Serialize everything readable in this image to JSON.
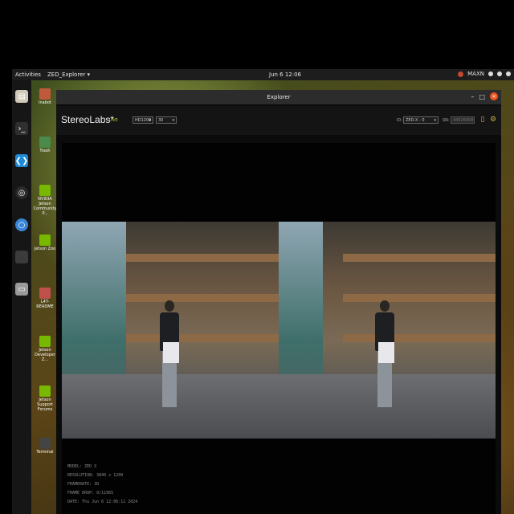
{
  "topbar": {
    "activities": "Activities",
    "app_menu": "ZED_Explorer ▾",
    "clock": "Jun 6 12:06",
    "power_mode": "MAXN"
  },
  "dock": {
    "items": [
      {
        "name": "files-icon",
        "color": "#cfc7b8"
      },
      {
        "name": "terminal-icon",
        "color": "#2f2f2f"
      },
      {
        "name": "vscode-icon",
        "color": "#1f8ad8"
      },
      {
        "name": "obs-icon",
        "color": "#2a2a2a"
      },
      {
        "name": "chromium-icon",
        "color": "#3a86d6"
      },
      {
        "name": "blank-icon",
        "color": "#3b3b3b"
      },
      {
        "name": "drive-icon",
        "color": "#9a9a9a"
      }
    ]
  },
  "desktop_icons": [
    {
      "label": "lnabot",
      "color": "#c05a3a"
    },
    {
      "label": "Trash",
      "color": "#4a8a4a"
    },
    {
      "label": "NVIDIA Jetson Community P...",
      "color": "#76b900"
    },
    {
      "label": "Jetson Zoo",
      "color": "#76b900"
    },
    {
      "label": "L4T-README",
      "color": "#c0504a"
    },
    {
      "label": "Jetson Developer Z...",
      "color": "#76b900"
    },
    {
      "label": "Jetson Support Forums",
      "color": "#76b900"
    },
    {
      "label": "Terminal",
      "color": "#444444"
    }
  ],
  "window": {
    "title": "Explorer",
    "brand": "StereoLabs*",
    "live": "LIVE",
    "resolution_select": "HD1200",
    "fps_select": "30",
    "id_label": "ID:",
    "id_select": "ZED-X - 0",
    "sn_label": "SN:",
    "sn_value": "44526908"
  },
  "info": {
    "model": "MODEL: ZED X",
    "resolution": "RESOLUTION: 3840 x 1200",
    "framerate": "FRAMERATE: 30",
    "frame_drop": "FRAME DROP: 0/11965",
    "date": "DATE: Thu Jun 6 12:06:11 2024"
  },
  "colors": {
    "accent": "#e95420",
    "live": "#b7c93a",
    "icon_gold": "#d0b34a"
  }
}
